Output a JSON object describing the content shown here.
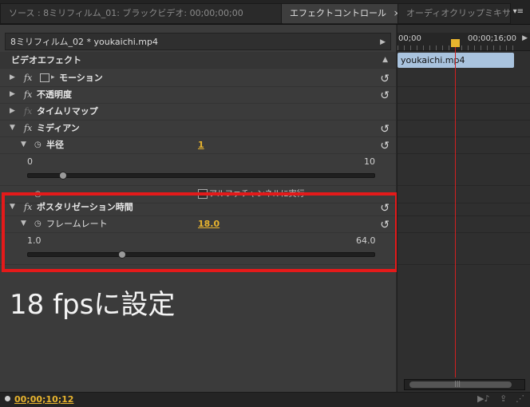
{
  "tabs": {
    "source": "ソース : 8ミリフィルム_01: ブラックビデオ: 00;00;00;00",
    "effect_controls": "エフェクトコントロール",
    "close": "×",
    "audio_mixer": "オーディオクリップミキサー",
    "menu": "▾≡"
  },
  "clip": {
    "title": "8ミリフィルム_02 * youkaichi.mp4",
    "expand": "▶"
  },
  "effects_header": "ビデオエフェクト",
  "collapse": "▲",
  "effects": {
    "motion": "モーション",
    "opacity": "不透明度",
    "time_remap": "タイムリマップ",
    "median": "ミディアン",
    "radius_label": "半径",
    "radius_value": "1",
    "radius_min": "0",
    "radius_max": "10",
    "alpha_partial": "アルファチャンネルに実行",
    "posterize": "ポスタリゼーション時間",
    "framerate_label": "フレームレート",
    "framerate_value": "18.0",
    "framerate_min": "1.0",
    "framerate_max": "64.0"
  },
  "slider_levels": {
    "radius": 0.1,
    "framerate": 0.27
  },
  "fx_symbol": "fx",
  "caption": "18 fpsに設定",
  "timeline": {
    "t_start": "00;00",
    "t_end": "00;00;16;00",
    "clip_name": "youkaichi.mp4"
  },
  "footer": {
    "timecode": "00;00;10;12"
  }
}
